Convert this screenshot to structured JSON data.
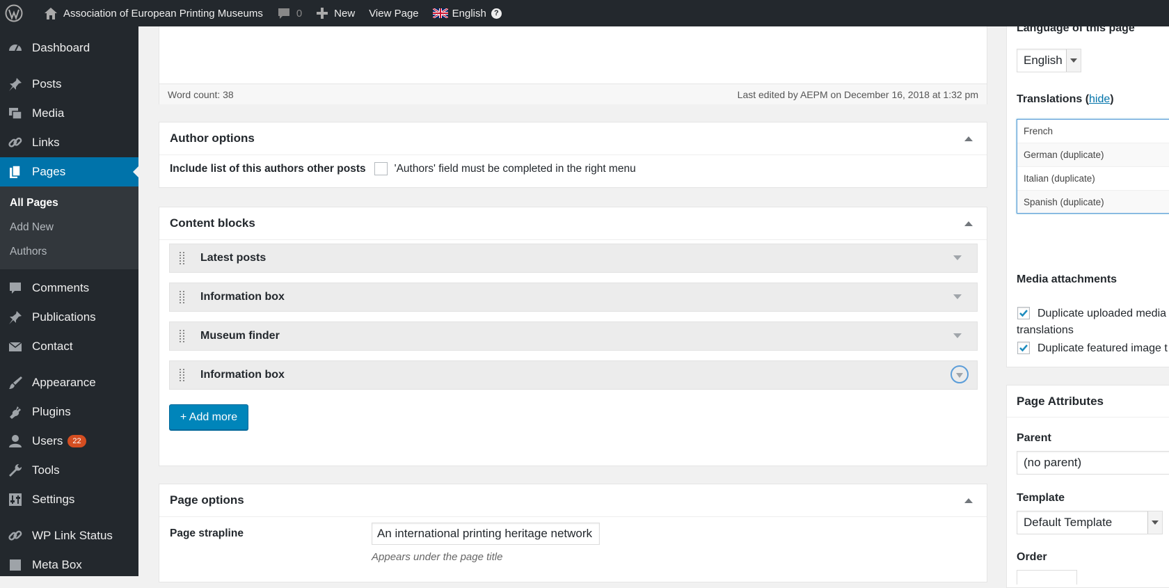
{
  "adminbar": {
    "site_name": "Association of European Printing Museums",
    "comments_count": "0",
    "new_label": "New",
    "view_label": "View Page",
    "language": "English",
    "help_symbol": "?"
  },
  "sidebar": {
    "items": [
      {
        "label": "Dashboard"
      },
      {
        "label": "Posts"
      },
      {
        "label": "Media"
      },
      {
        "label": "Links"
      },
      {
        "label": "Pages"
      },
      {
        "label": "Comments"
      },
      {
        "label": "Publications"
      },
      {
        "label": "Contact"
      },
      {
        "label": "Appearance"
      },
      {
        "label": "Plugins"
      },
      {
        "label": "Users",
        "badge": "22"
      },
      {
        "label": "Tools"
      },
      {
        "label": "Settings"
      },
      {
        "label": "WP Link Status"
      },
      {
        "label": "Meta Box"
      }
    ],
    "submenu": [
      "All Pages",
      "Add New",
      "Authors"
    ]
  },
  "editor": {
    "word_count": "Word count: 38",
    "last_edited": "Last edited by AEPM on December 16, 2018 at 1:32 pm"
  },
  "author_options": {
    "title": "Author options",
    "field_label": "Include list of this authors other posts",
    "field_note": "'Authors' field must be completed in the right menu"
  },
  "content_blocks": {
    "title": "Content blocks",
    "blocks": [
      "Latest posts",
      "Information box",
      "Museum finder",
      "Information box"
    ],
    "add_more": "+ Add more"
  },
  "page_options": {
    "title": "Page options",
    "strapline_label": "Page strapline",
    "strapline_value": "An international printing heritage network",
    "strapline_hint": "Appears under the page title"
  },
  "language_box": {
    "language_label": "Language of this page",
    "language_value": "English",
    "translations_label": "Translations (",
    "hide_link": "hide",
    "close_paren": ")",
    "translations": [
      "French",
      "German (duplicate)",
      "Italian (duplicate)",
      "Spanish (duplicate)"
    ],
    "media_label": "Media attachments",
    "dup_media": "Duplicate uploaded media",
    "dup_media_cont": "translations",
    "dup_featured": "Duplicate featured image t"
  },
  "page_attributes": {
    "title": "Page Attributes",
    "parent_label": "Parent",
    "parent_value": "(no parent)",
    "template_label": "Template",
    "template_value": "Default Template",
    "order_label": "Order"
  },
  "colors": {
    "adminbar": "#23282d",
    "sidebar": "#23282d",
    "accent": "#0073aa",
    "button": "#0085ba",
    "badge": "#d54e21"
  }
}
